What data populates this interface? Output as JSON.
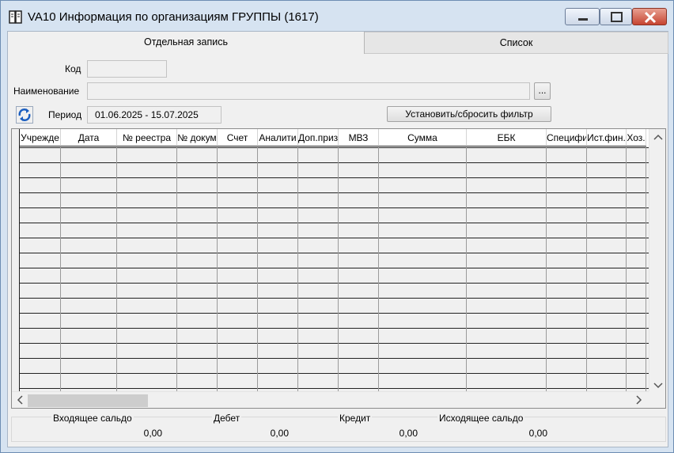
{
  "window": {
    "title": "VA10 Информация по организациям ГРУППЫ (1617)"
  },
  "tabs": [
    {
      "label": "Отдельная запись"
    },
    {
      "label": "Список"
    }
  ],
  "form": {
    "code_label": "Код",
    "code_value": "",
    "name_label": "Наименование",
    "name_value": "",
    "browse_label": "...",
    "period_label": "Период",
    "period_value": "01.06.2025  -  15.07.2025",
    "filter_button": "Установить/сбросить фильтр"
  },
  "table": {
    "columns": [
      "Учрежде",
      "Дата",
      "№ реестра",
      "№ докум",
      "Счет",
      "Аналити",
      "Доп.приз",
      "МВЗ",
      "Сумма",
      "ЕБК",
      "Специфи",
      "Ист.фин.",
      "Хоз."
    ],
    "rows": []
  },
  "totals": {
    "opening_label": "Входящее сальдо",
    "opening_value": "0,00",
    "debit_label": "Дебет",
    "debit_value": "0,00",
    "credit_label": "Кредит",
    "credit_value": "0,00",
    "closing_label": "Исходящее сальдо",
    "closing_value": "0,00"
  },
  "icons": {
    "app": "book-icon",
    "refresh": "refresh-icon",
    "minimize": "minimize-icon",
    "maximize": "maximize-icon",
    "close": "close-icon"
  },
  "colors": {
    "title_bar": "#d6e3f1",
    "close_button": "#c64532",
    "panel": "#f0f0f0"
  }
}
